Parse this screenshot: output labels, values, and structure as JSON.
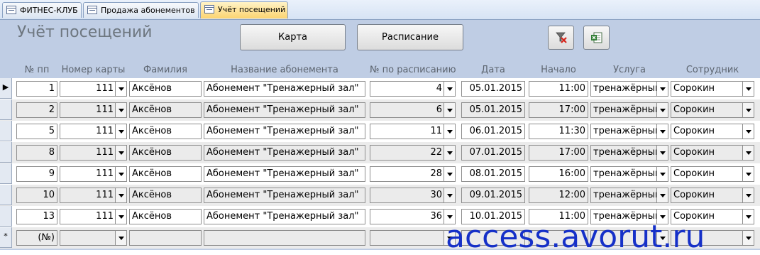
{
  "tabs": [
    {
      "label": "ФИТНЕС-КЛУБ",
      "active": false
    },
    {
      "label": "Продажа абонементов",
      "active": false
    },
    {
      "label": "Учёт посещений",
      "active": true
    }
  ],
  "form": {
    "title": "Учёт посещений",
    "buttons": {
      "card": "Карта",
      "schedule": "Расписание",
      "filter_icon": "clear-filter-icon",
      "excel_icon": "export-excel-icon"
    }
  },
  "columns": [
    "№ пп",
    "Номер карты",
    "Фамилия",
    "Название абонемента",
    "№ по расписанию",
    "Дата",
    "Начало",
    "Услуга",
    "Сотрудник"
  ],
  "rows": [
    {
      "pp": "1",
      "card": "111",
      "surname": "Аксёнов",
      "subscription": "Абонемент \"Тренажерный зал\"",
      "schedule_no": "4",
      "date": "05.01.2015",
      "start": "11:00",
      "service": "тренажёрный",
      "staff": "Сорокин"
    },
    {
      "pp": "2",
      "card": "111",
      "surname": "Аксёнов",
      "subscription": "Абонемент \"Тренажерный зал\"",
      "schedule_no": "6",
      "date": "05.01.2015",
      "start": "17:00",
      "service": "тренажёрный",
      "staff": "Сорокин"
    },
    {
      "pp": "5",
      "card": "111",
      "surname": "Аксёнов",
      "subscription": "Абонемент \"Тренажерный зал\"",
      "schedule_no": "11",
      "date": "06.01.2015",
      "start": "11:30",
      "service": "тренажёрный",
      "staff": "Сорокин"
    },
    {
      "pp": "8",
      "card": "111",
      "surname": "Аксёнов",
      "subscription": "Абонемент \"Тренажерный зал\"",
      "schedule_no": "22",
      "date": "07.01.2015",
      "start": "17:00",
      "service": "тренажёрный",
      "staff": "Сорокин"
    },
    {
      "pp": "9",
      "card": "111",
      "surname": "Аксёнов",
      "subscription": "Абонемент \"Тренажерный зал\"",
      "schedule_no": "28",
      "date": "08.01.2015",
      "start": "16:00",
      "service": "тренажёрный",
      "staff": "Сорокин"
    },
    {
      "pp": "10",
      "card": "111",
      "surname": "Аксёнов",
      "subscription": "Абонемент \"Тренажерный зал\"",
      "schedule_no": "30",
      "date": "09.01.2015",
      "start": "12:00",
      "service": "тренажёрный",
      "staff": "Сорокин"
    },
    {
      "pp": "13",
      "card": "111",
      "surname": "Аксёнов",
      "subscription": "Абонемент \"Тренажерный зал\"",
      "schedule_no": "36",
      "date": "10.01.2015",
      "start": "11:00",
      "service": "тренажёрный",
      "staff": "Сорокин"
    }
  ],
  "new_row": {
    "pp": "(№)",
    "selector": "*"
  },
  "current_row_marker": "▶",
  "watermark": "access.avorut.ru"
}
